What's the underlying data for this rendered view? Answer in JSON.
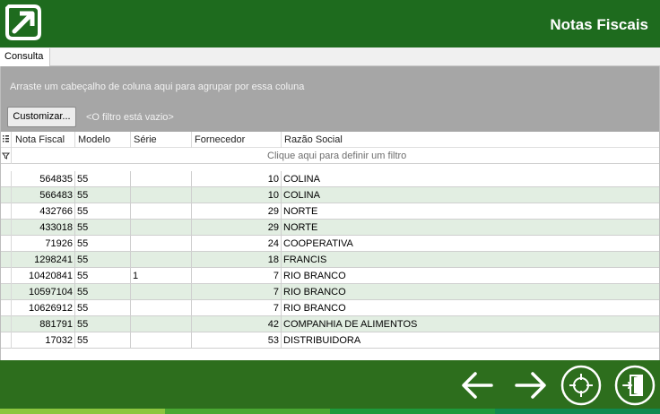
{
  "header": {
    "title": "Notas Fiscais",
    "logo_icon": "arrow-logo-icon"
  },
  "tabs": [
    {
      "label": "Consulta"
    }
  ],
  "group_panel": {
    "hint": "Arraste um cabeçalho de coluna aqui para agrupar por essa coluna",
    "customize_label": "Customizar...",
    "filter_status": "<O filtro está vazio>"
  },
  "grid": {
    "columns": [
      "Nota Fiscal",
      "Modelo",
      "Série",
      "Fornecedor",
      "Razão Social"
    ],
    "filter_hint": "Clique aqui para definir um filtro",
    "rows": [
      {
        "nota": "564835",
        "modelo": "55",
        "serie": "",
        "fornecedor": "10",
        "razao": "COLINA"
      },
      {
        "nota": "566483",
        "modelo": "55",
        "serie": "",
        "fornecedor": "10",
        "razao": "COLINA"
      },
      {
        "nota": "432766",
        "modelo": "55",
        "serie": "",
        "fornecedor": "29",
        "razao": "NORTE"
      },
      {
        "nota": "433018",
        "modelo": "55",
        "serie": "",
        "fornecedor": "29",
        "razao": "NORTE"
      },
      {
        "nota": "71926",
        "modelo": "55",
        "serie": "",
        "fornecedor": "24",
        "razao": "COOPERATIVA"
      },
      {
        "nota": "1298241",
        "modelo": "55",
        "serie": "",
        "fornecedor": "18",
        "razao": "FRANCIS"
      },
      {
        "nota": "10420841",
        "modelo": "55",
        "serie": "1",
        "fornecedor": "7",
        "razao": "RIO BRANCO"
      },
      {
        "nota": "10597104",
        "modelo": "55",
        "serie": "",
        "fornecedor": "7",
        "razao": "RIO BRANCO"
      },
      {
        "nota": "10626912",
        "modelo": "55",
        "serie": "",
        "fornecedor": "7",
        "razao": "RIO BRANCO"
      },
      {
        "nota": "881791",
        "modelo": "55",
        "serie": "",
        "fornecedor": "42",
        "razao": "COMPANHIA DE ALIMENTOS"
      },
      {
        "nota": "17032",
        "modelo": "55",
        "serie": "",
        "fornecedor": "53",
        "razao": "DISTRIBUIDORA"
      }
    ]
  },
  "footer": {
    "buttons": [
      {
        "icon": "arrow-left-icon"
      },
      {
        "icon": "arrow-right-icon"
      },
      {
        "icon": "crosshair-icon"
      },
      {
        "icon": "exit-door-icon"
      }
    ]
  },
  "colors": {
    "brand_green": "#1e6b1e",
    "footer_green": "#2d6e1d",
    "row_alt": "#e2eee2",
    "group_panel_gray": "#a6a6a6"
  }
}
